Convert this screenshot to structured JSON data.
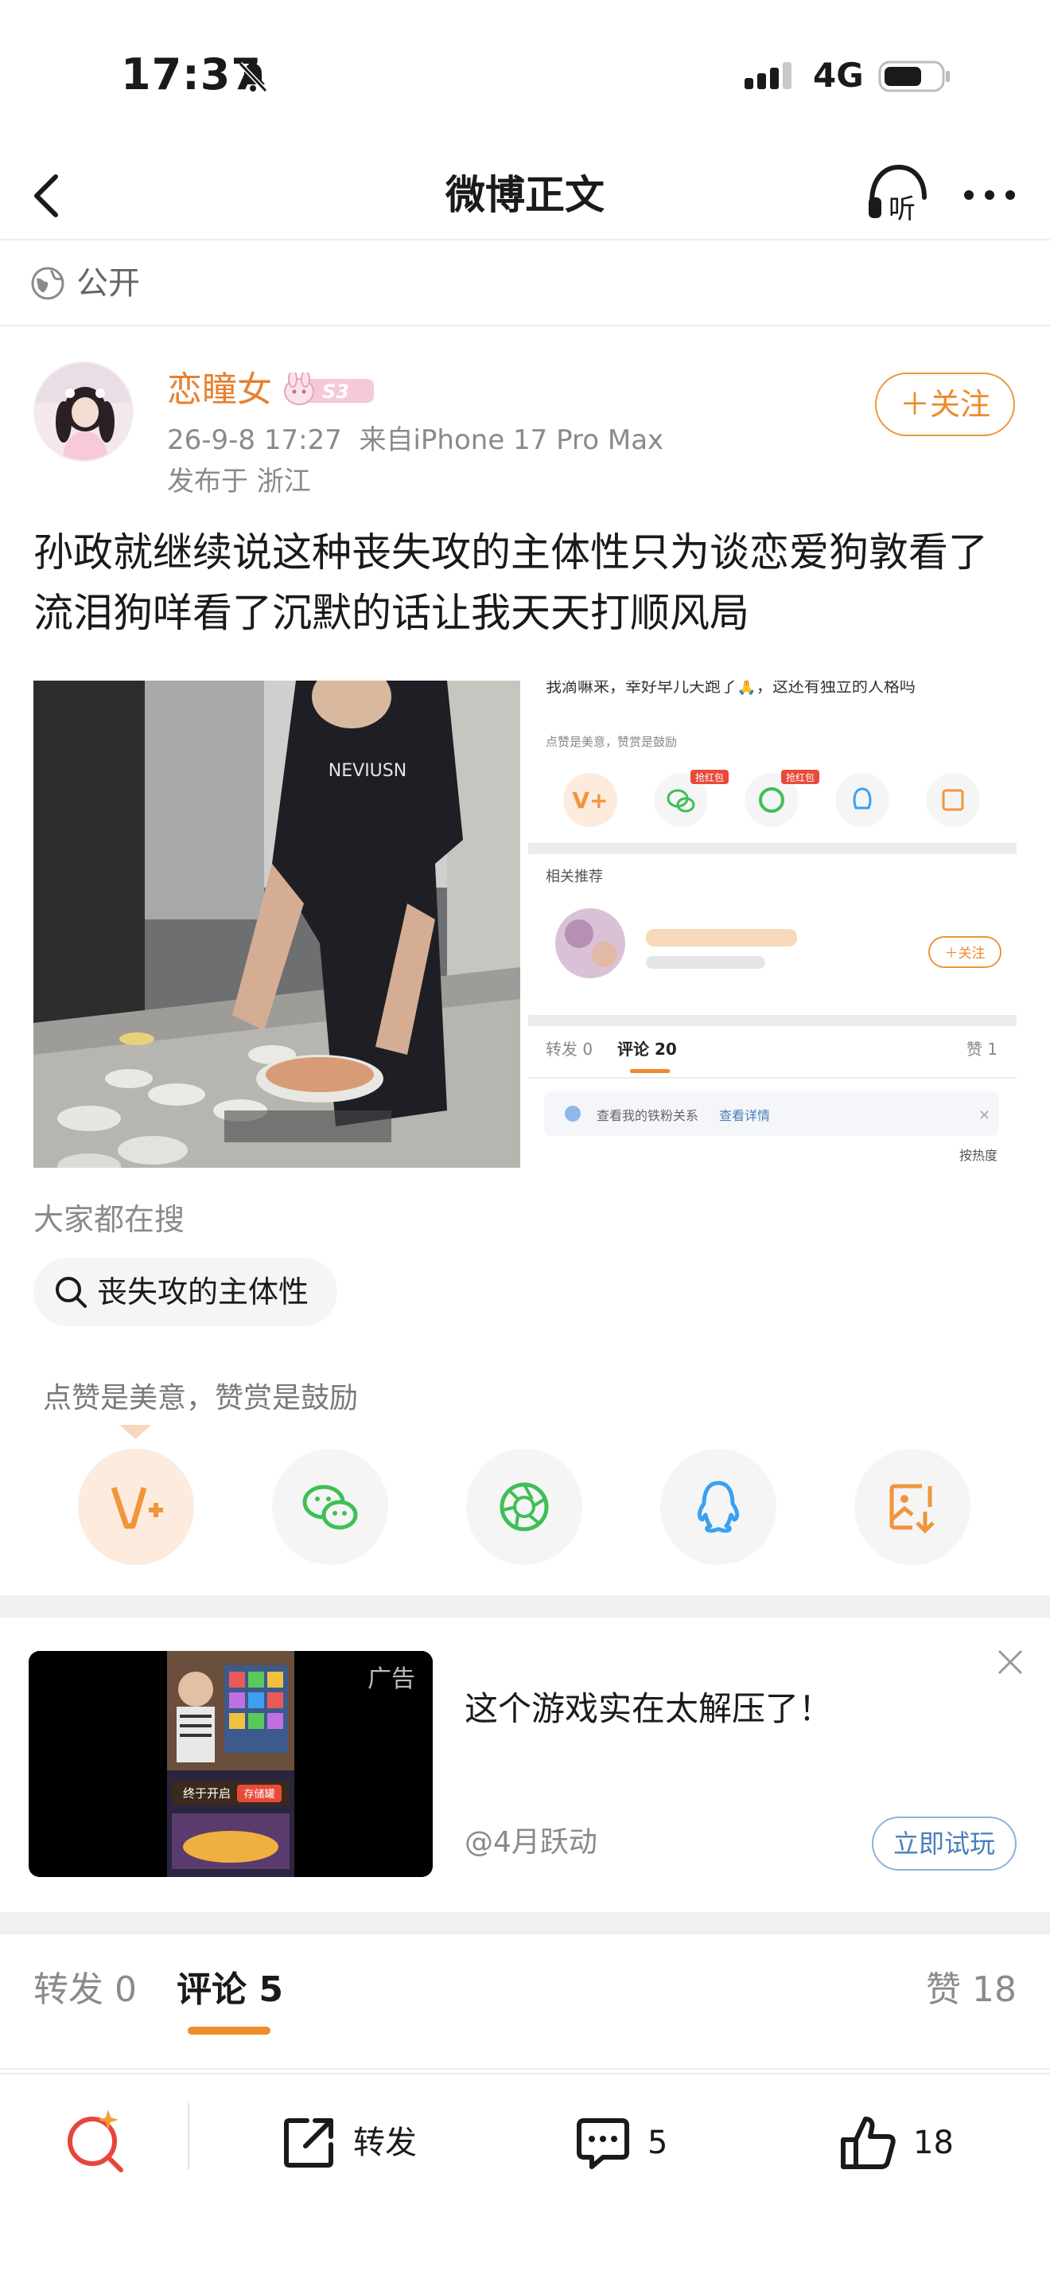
{
  "status_bar": {
    "time": "17:37",
    "network": "4G"
  },
  "nav": {
    "title": "微博正文"
  },
  "visibility": {
    "label": "公开"
  },
  "author": {
    "name": "恋瞳女",
    "badge": "S3",
    "meta": "26-9-8 17:27  来自iPhone 17 Pro Max",
    "location": "发布于 浙江",
    "follow_label": "＋关注"
  },
  "post": {
    "text": "孙政就继续说这种丧失攻的主体性只为谈恋爱狗敦看了流泪狗咩看了沉默的话让我天天打顺风局"
  },
  "screenshot_thumb": {
    "top_text": "我滴嘛来，幸好早几天跑了🙏，这还有独立的人格吗",
    "reward_hint": "点赞是美意，赞赏是鼓励",
    "red_tag": "抢红包",
    "related": "相关推荐",
    "follow": "＋关注",
    "tabs": [
      "转发 0",
      "评论 20",
      "赞 1"
    ],
    "tip": "查看我的铁粉关系",
    "tip_link": "查看详情",
    "sort": "按热度"
  },
  "hot_search": {
    "label": "大家都在搜",
    "query": "丧失攻的主体性"
  },
  "reward": {
    "hint": "点赞是美意，赞赏是鼓励"
  },
  "share_targets": [
    "reward-icon",
    "wechat-icon",
    "moments-icon",
    "qq-icon",
    "save-image-icon"
  ],
  "ad": {
    "label": "广告",
    "title": "这个游戏实在太解压了！",
    "advertiser": "@4月跃动",
    "cta": "立即试玩",
    "video_caption": "终于开启",
    "video_tag": "存储罐"
  },
  "tabs": {
    "repost": "转发 0",
    "comment": "评论 5",
    "like": "赞 18"
  },
  "bottom_bar": {
    "repost": "转发",
    "comment_count": "5",
    "like_count": "18"
  },
  "colors": {
    "accent_orange": "#ee8a2a",
    "link_blue": "#4a7fb6",
    "wechat_green": "#3fbf55",
    "qq_blue": "#3aa0f0"
  }
}
